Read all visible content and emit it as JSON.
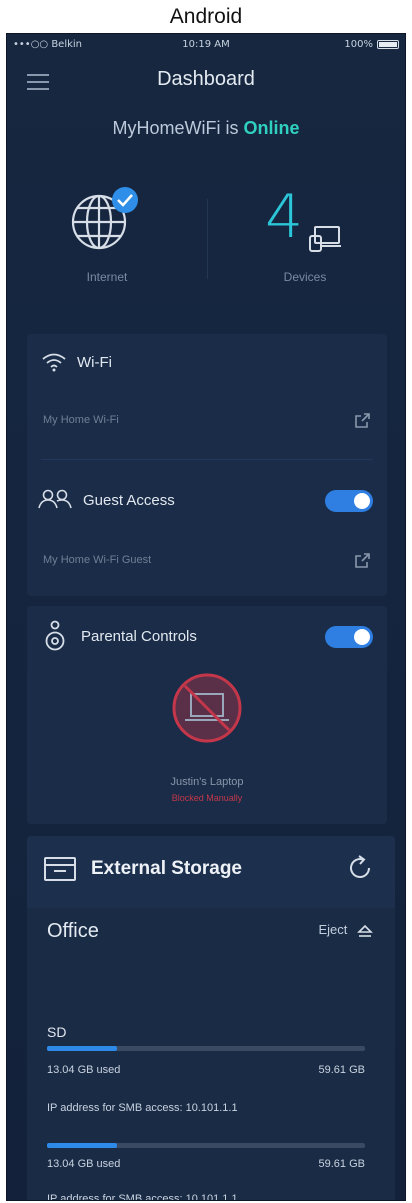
{
  "caption": "Android",
  "statusbar": {
    "carrier": "•••○○ Belkin",
    "time": "10:19 AM",
    "battery": "100%"
  },
  "header": {
    "title": "Dashboard"
  },
  "network": {
    "name": "MyHomeWiFi",
    "connector": "is",
    "state": "Online"
  },
  "internet": {
    "label": "Internet",
    "connected": true
  },
  "devices": {
    "count": "4",
    "label": "Devices"
  },
  "wifi": {
    "title": "Wi-Fi",
    "network_name": "My Home Wi-Fi"
  },
  "guest": {
    "title": "Guest Access",
    "network_name": "My Home Wi-Fi Guest",
    "enabled": true
  },
  "parental": {
    "title": "Parental Controls",
    "enabled": true,
    "device_name": "Justin's Laptop",
    "device_status": "Blocked Manually"
  },
  "storage": {
    "title": "External Storage",
    "drive_name": "Office",
    "eject_label": "Eject",
    "volume_label": "SD",
    "volumes": [
      {
        "used": "13.04 GB used",
        "total": "59.61 GB",
        "used_fraction": 0.22,
        "ip_text": "IP address for SMB access: 10.101.1.1"
      },
      {
        "used": "13.04 GB used",
        "total": "59.61 GB",
        "used_fraction": 0.22,
        "ip_text": "IP address for SMB access: 10.101.1.1"
      }
    ]
  },
  "colors": {
    "accent": "#2fd0c0",
    "toggle_on": "#2f7fe3",
    "blocked": "#c4374a",
    "background": "#16273f"
  }
}
